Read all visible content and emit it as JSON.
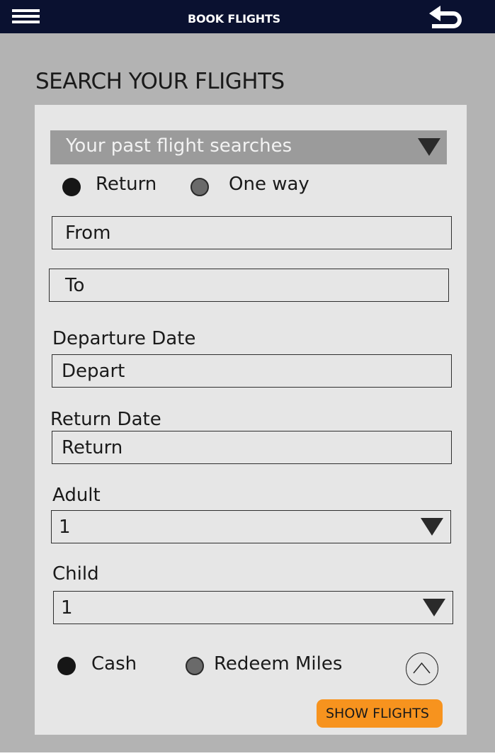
{
  "header": {
    "title": "BOOK FLIGHTS",
    "menu_icon": "hamburger-menu-icon",
    "back_icon": "back-arrow-icon"
  },
  "page": {
    "heading": "SEARCH YOUR FLIGHTS"
  },
  "past_searches": {
    "label": "Your past flight searches",
    "icon": "triangle-down-icon"
  },
  "trip_type": {
    "options": [
      {
        "label": "Return",
        "selected": true
      },
      {
        "label": "One way",
        "selected": false
      }
    ]
  },
  "from_field": {
    "placeholder": "From"
  },
  "to_field": {
    "placeholder": "To"
  },
  "departure": {
    "label": "Departure Date",
    "placeholder": "Depart"
  },
  "return_date": {
    "label": "Return Date",
    "placeholder": "Return"
  },
  "adult": {
    "label": "Adult",
    "value": "1"
  },
  "child": {
    "label": "Child",
    "value": "1"
  },
  "payment": {
    "options": [
      {
        "label": "Cash",
        "selected": true
      },
      {
        "label": "Redeem Miles",
        "selected": false
      }
    ]
  },
  "scroll_up_icon": "chevron-up-icon",
  "show_flights": {
    "label": "SHOW FLIGHTS"
  },
  "colors": {
    "topbar": "#0a1130",
    "background": "#b3b3b3",
    "card": "#e6e6e6",
    "dropdown": "#9b9b9b",
    "accent": "#f7931e"
  }
}
